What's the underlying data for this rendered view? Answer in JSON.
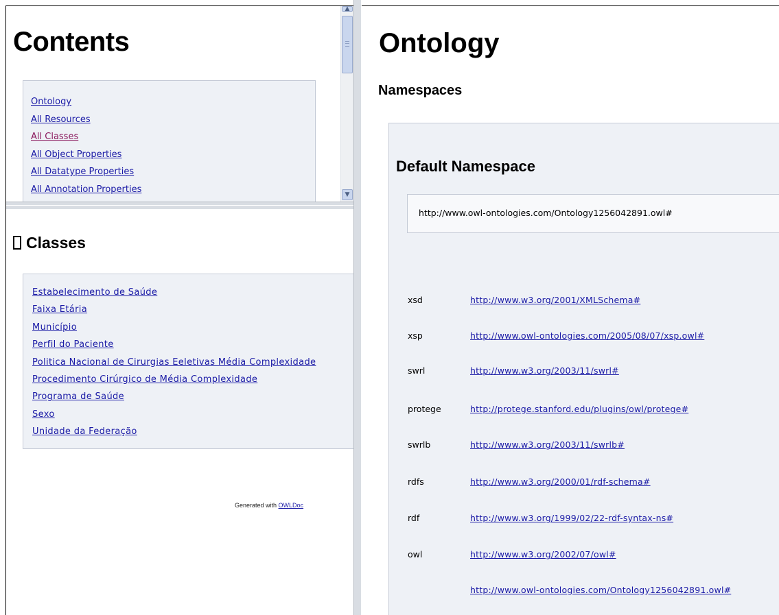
{
  "contents": {
    "title": "Contents",
    "links": [
      {
        "label": "Ontology",
        "visited": false
      },
      {
        "label": "All Resources",
        "visited": false
      },
      {
        "label": "All Classes",
        "visited": true
      },
      {
        "label": "All Object Properties",
        "visited": false
      },
      {
        "label": "All Datatype Properties",
        "visited": false
      },
      {
        "label": "All Annotation Properties",
        "visited": false
      }
    ]
  },
  "classes": {
    "title": "Classes",
    "items": [
      "Estabelecimento de Saúde",
      "Faixa Etária",
      "Município",
      "Perfil do Paciente",
      "Politica Nacional de Cirurgias Eeletivas Média Complexidade",
      "Procedimento Cirúrgico de Média Complexidade",
      "Programa de Saúde",
      "Sexo",
      "Unidade da Federação"
    ],
    "generated_prefix": "Generated with ",
    "generated_link": "OWLDoc"
  },
  "ontology": {
    "title": "Ontology",
    "namespaces_title": "Namespaces",
    "default_title": "Default Namespace",
    "default_uri": "http://www.owl-ontologies.com/Ontology1256042891.owl#",
    "namespaces": [
      {
        "prefix": "xsd",
        "uri": "http://www.w3.org/2001/XMLSchema#"
      },
      {
        "prefix": "xsp",
        "uri": "http://www.owl-ontologies.com/2005/08/07/xsp.owl#"
      },
      {
        "prefix": "swrl",
        "uri": "http://www.w3.org/2003/11/swrl#"
      },
      {
        "prefix": "protege",
        "uri": "http://protege.stanford.edu/plugins/owl/protege#"
      },
      {
        "prefix": "swrlb",
        "uri": "http://www.w3.org/2003/11/swrlb#"
      },
      {
        "prefix": "rdfs",
        "uri": "http://www.w3.org/2000/01/rdf-schema#"
      },
      {
        "prefix": "rdf",
        "uri": "http://www.w3.org/1999/02/22-rdf-syntax-ns#"
      },
      {
        "prefix": "owl",
        "uri": "http://www.w3.org/2002/07/owl#"
      },
      {
        "prefix": "",
        "uri": "http://www.owl-ontologies.com/Ontology1256042891.owl#"
      }
    ]
  },
  "colors": {
    "link": "#1a1aa6",
    "visited_link": "#8b1a5e",
    "panel_bg": "#eef1f6",
    "panel_border": "#c4cad6"
  }
}
